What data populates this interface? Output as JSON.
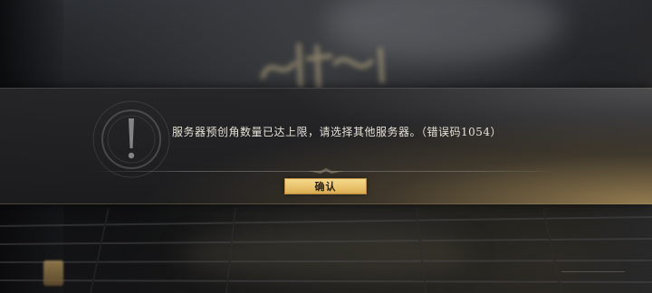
{
  "dialog": {
    "message": "服务器预创角数量已达上限，请选择其他服务器。（错误码1054）",
    "confirm_label": "确认",
    "icon": "exclamation-icon"
  },
  "colors": {
    "button_gold": "#e9c16a",
    "text_light": "#e6e2d8",
    "band_dark": "#262628"
  }
}
